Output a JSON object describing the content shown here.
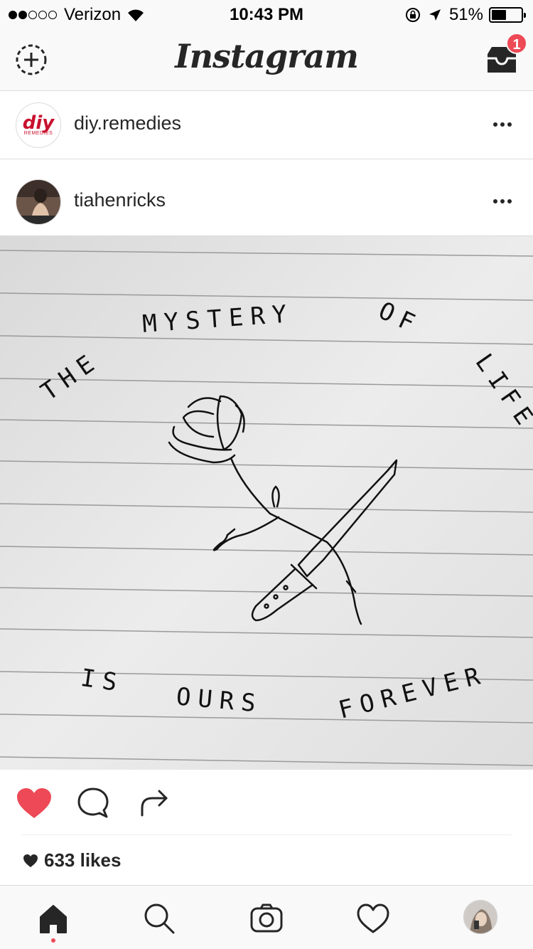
{
  "status_bar": {
    "carrier": "Verizon",
    "time": "10:43 PM",
    "battery_percent": "51%",
    "battery_level": 0.51,
    "signal_bars_filled": 2,
    "signal_bars_total": 5
  },
  "header": {
    "logo": "Instagram",
    "new_story_icon": "new-story-icon",
    "inbox_icon": "inbox-icon",
    "inbox_badge": "1"
  },
  "posts": [
    {
      "username": "diy.remedies",
      "avatar": "diy-logo",
      "avatar_text": "diy",
      "avatar_subtext": "REMEDIES"
    },
    {
      "username": "tiahenricks",
      "avatar": "user-photo"
    }
  ],
  "post_image": {
    "lines": [
      "MYSTERY",
      "THE",
      "OF",
      "LIFE",
      "IS",
      "OURS",
      "FOREVER"
    ]
  },
  "actions": {
    "like_icon": "heart-filled-icon",
    "comment_icon": "comment-icon",
    "share_icon": "share-icon",
    "liked": true
  },
  "likes": {
    "count_label": "633 likes"
  },
  "tab_bar": {
    "items": [
      "home-icon",
      "search-icon",
      "camera-icon",
      "activity-icon",
      "profile-icon"
    ],
    "active": "home"
  },
  "colors": {
    "accent_red": "#ed4956",
    "text": "#262626",
    "border": "#dbdbdb"
  }
}
